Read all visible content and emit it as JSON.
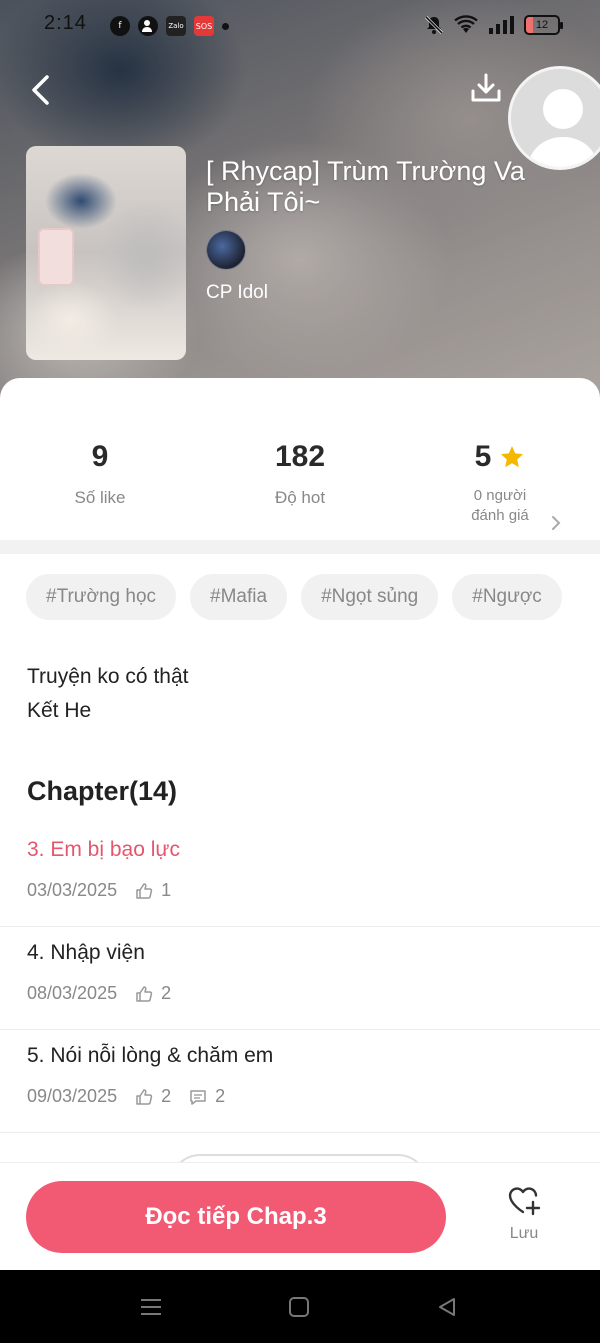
{
  "status_bar": {
    "time": "2:14",
    "left_icons": [
      "facebook-icon",
      "person-add-icon",
      "zalo-icon",
      "sos-icon",
      "dot-icon"
    ],
    "zalo_label": "Zalo",
    "sos_label": "SOS",
    "right_icons": [
      "silent-bell-icon",
      "wifi-icon",
      "signal-icon",
      "battery-icon"
    ],
    "battery_level": "12"
  },
  "header": {
    "back_icon": "chevron-left-icon",
    "download_icon": "download-icon"
  },
  "story": {
    "title": "[ Rhycap] Trùm Trường Va Phải Tôi~",
    "author": "CP Idol"
  },
  "stats": {
    "likes_value": "9",
    "likes_label": "Số like",
    "hot_value": "182",
    "hot_label": "Độ hot",
    "rating_value": "5",
    "rating_label_line1": "0 người",
    "rating_label_line2": "đánh giá",
    "star_color": "#f5b800"
  },
  "tags": [
    "#Trường học",
    "#Mafia",
    "#Ngọt sủng",
    "#Ngược"
  ],
  "description": {
    "line1": "Truyện ko có thật",
    "line2": "Kết He"
  },
  "chapters": {
    "heading": "Chapter(14)",
    "items": [
      {
        "title": "3. Em bị bạo lực",
        "date": "03/03/2025",
        "likes": "1",
        "comments": null,
        "active": true
      },
      {
        "title": "4. Nhập viện",
        "date": "08/03/2025",
        "likes": "2",
        "comments": null,
        "active": false
      },
      {
        "title": "5. Nói nỗi lòng & chăm em",
        "date": "09/03/2025",
        "likes": "2",
        "comments": "2",
        "active": false
      }
    ]
  },
  "actions": {
    "read_label": "Đọc tiếp Chap.3",
    "save_label": "Lưu",
    "accent_color": "#f25a73"
  },
  "system_nav": [
    "menu-icon",
    "home-icon",
    "back-triangle-icon"
  ]
}
